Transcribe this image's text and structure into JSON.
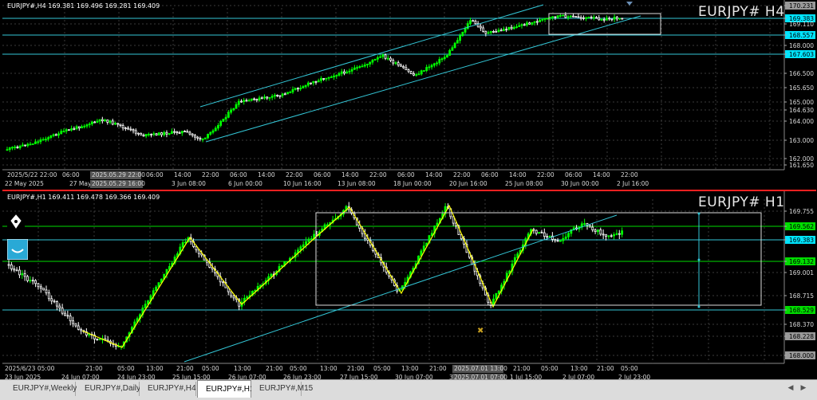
{
  "h4": {
    "info": "EURJPY#,H4  169.381 169.496 169.281 169.409",
    "label": "EURJPY# H4",
    "price_ticks": [
      "170.231",
      "169.383",
      "169.110",
      "168.557",
      "168.000",
      "167.603",
      "166.500",
      "165.650",
      "165.000",
      "164.630",
      "164.000",
      "163.000",
      "162.000",
      "161.650"
    ],
    "time_ticks": [
      "2025/5/22 22:00",
      "06:00",
      "2025.05.29 22:00",
      "06:00",
      "14:00",
      "22:00",
      "3 Jun 08:00",
      "06:00",
      "14:00",
      "22:00",
      "06:00",
      "14:00",
      "22:00",
      "06:00",
      "14:00",
      "22:00",
      "06:00",
      "14:00",
      "22:00",
      "06:00",
      "14:00",
      "22:00"
    ],
    "time_labels_bottom": [
      "22 May 2025",
      "27 May 00",
      "2025.05.29 16:00",
      "3 Jun 08:00",
      "6 Jun 00:00",
      "10 Jun 16:00",
      "13 Jun 08:00",
      "18 Jun 00:00",
      "20 Jun 16:00",
      "25 Jun 08:00",
      "30 Jun 00:00",
      "2 Jul 16:00"
    ]
  },
  "h1": {
    "info": "EURJPY#,H1  169.411 169.478 169.366 169.409",
    "label": "EURJPY# H1",
    "price_ticks": [
      "169.755",
      "169.562",
      "169.383",
      "169.132",
      "169.001",
      "168.715",
      "168.529",
      "168.370",
      "168.228",
      "168.000"
    ],
    "time_ticks": [
      "2025/6/23 05:00",
      "13:00",
      "21:00",
      "05:00",
      "13:00",
      "21:00",
      "05:00",
      "13:00",
      "21:00",
      "05:00",
      "13:00",
      "21:00",
      "05:00",
      "13:00",
      "21:00",
      "05:00",
      "13:00",
      "2025.07.01 13:00",
      "21:00",
      "05:00",
      "13:00",
      "21:00",
      "05:00"
    ],
    "time_labels_bottom": [
      "23 Jun 2025",
      "24 Jun 07:00",
      "24 Jun 23:00",
      "25 Jun 15:00",
      "26 Jun 07:00",
      "26 Jun 23:00",
      "27 Jun 15:00",
      "30 Jun 07:00",
      "30 Jun 23:00",
      "2025.07.01 07:00",
      "1 Jul 15:00",
      "2 Jul 07:00",
      "2 Jul 23:00"
    ]
  },
  "tabs": [
    "EURJPY#,Weekly",
    "EURJPY#,Daily",
    "EURJPY#,H4",
    "EURJPY#,H1",
    "EURJPY#,M15"
  ],
  "active_tab": 3,
  "colors": {
    "bull": "#00ff00",
    "bear": "#ffffff",
    "channel": "#33c6d6",
    "zigzag": "#ffff00",
    "grid": "#3a3a3a",
    "highlight_price": "#00e5ff",
    "green_price": "#00dd00"
  }
}
